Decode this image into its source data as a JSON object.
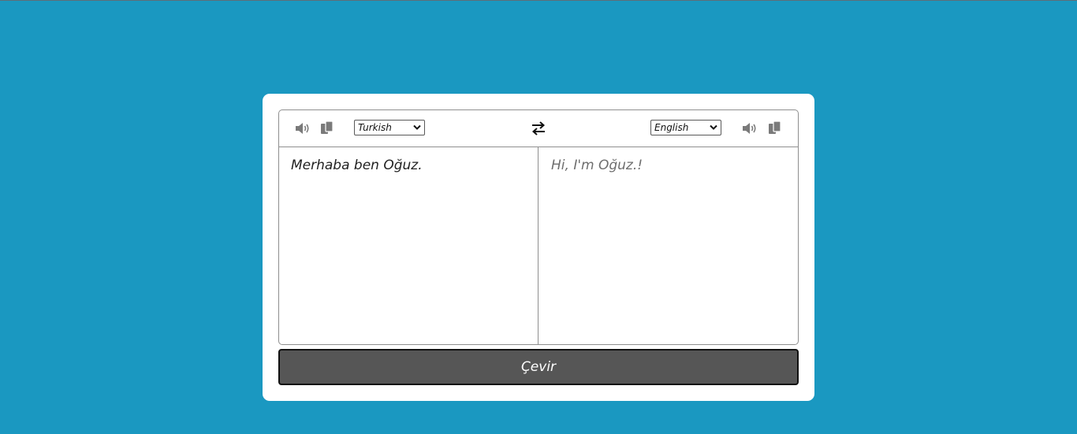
{
  "source": {
    "language": "Turkish",
    "text": "Merhaba ben Oğuz.",
    "speak_icon": "speaker-icon",
    "copy_icon": "copy-icon"
  },
  "target": {
    "language": "English",
    "text": "Hi, I'm Oğuz.!",
    "speak_icon": "speaker-icon",
    "copy_icon": "copy-icon"
  },
  "swap_icon": "swap-arrows-icon",
  "translate_button": {
    "label": "Çevir"
  },
  "colors": {
    "background": "#1a98c1",
    "card": "#ffffff",
    "button": "#565656",
    "icon": "#777777"
  }
}
